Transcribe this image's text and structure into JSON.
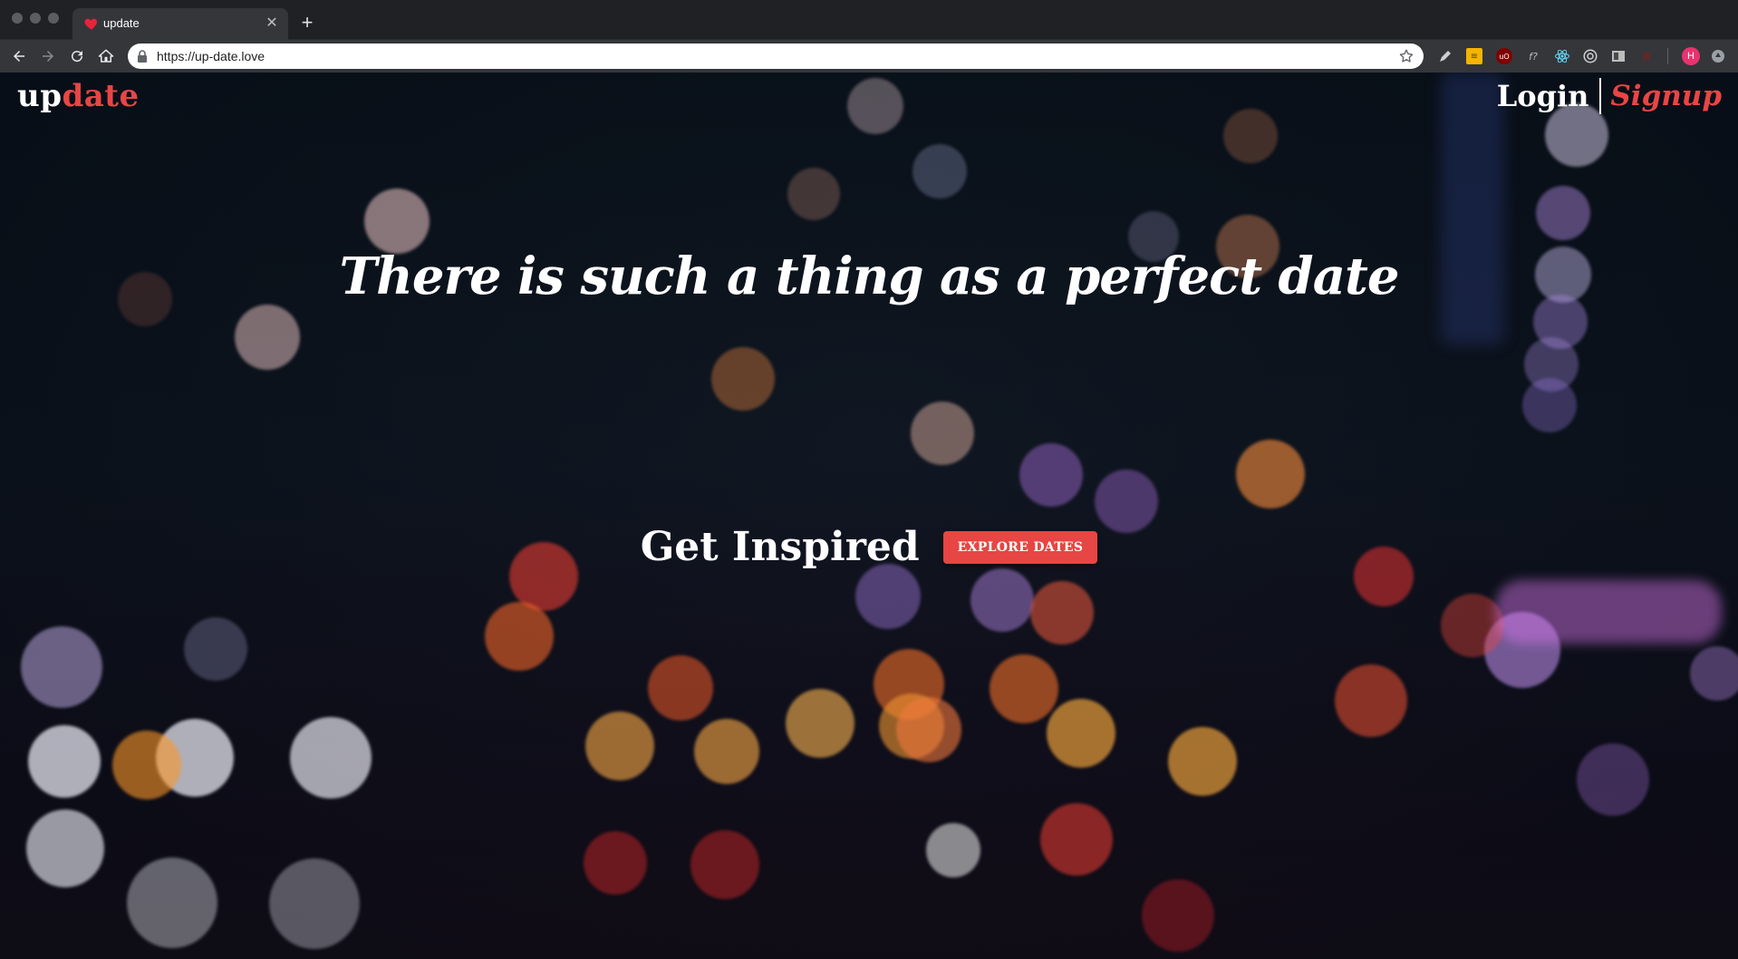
{
  "browser": {
    "tab_title": "update",
    "url": "https://up-date.love",
    "profile_initial": "H",
    "extensions": [
      "pen-icon",
      "notes-icon",
      "ublock-icon",
      "font-icon",
      "react-icon",
      "target-icon",
      "layout-icon",
      "puzzle-icon"
    ]
  },
  "site": {
    "logo_part1": "up",
    "logo_part2": "date",
    "login_label": "Login",
    "signup_label": "Signup",
    "headline": "There is such a thing as a perfect date",
    "cta_text": "Get Inspired",
    "cta_button": "EXPLORE DATES"
  },
  "colors": {
    "accent": "#e84545",
    "background": "#0b141d"
  }
}
